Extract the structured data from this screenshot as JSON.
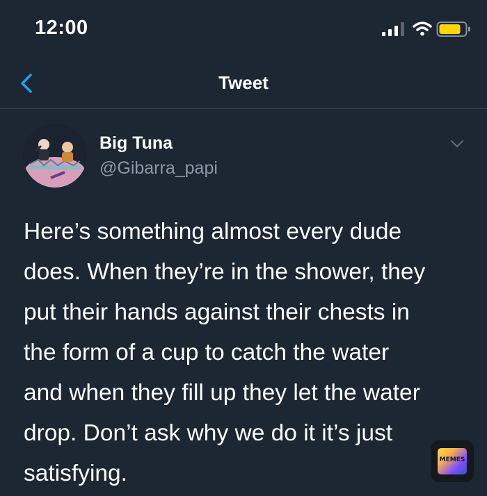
{
  "status_bar": {
    "time": "12:00",
    "icons": [
      "cellular-signal-icon",
      "wifi-icon",
      "battery-icon"
    ]
  },
  "nav": {
    "back_icon": "chevron-left-icon",
    "title": "Tweet"
  },
  "tweet": {
    "author": {
      "display_name": "Big Tuna",
      "handle": "@Gibarra_papi"
    },
    "more_icon": "chevron-down-icon",
    "text_lines": [
      "Here’s something almost every dude",
      "does. When they’re in the shower, they",
      "put their hands against their chests in",
      "the form of a cup to catch the water",
      "and when they fill up they let the water",
      "drop. Don’t ask why we do it it’s just",
      "satisfying."
    ]
  },
  "watermark": {
    "label": "MEMES"
  },
  "colors": {
    "background": "#1d2733",
    "accent": "#1da1f2",
    "secondary_text": "#8c98a6",
    "divider": "#3d4753",
    "battery": "#ffd60a"
  }
}
